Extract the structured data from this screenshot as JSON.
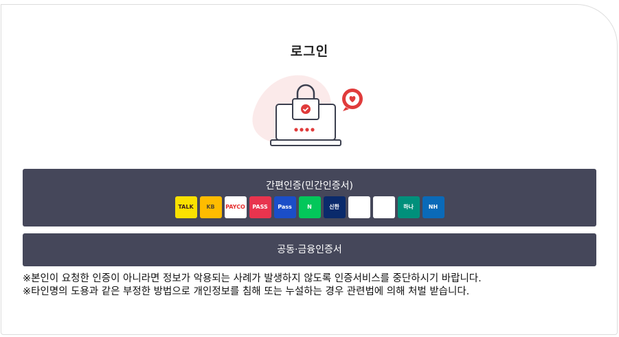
{
  "page": {
    "title": "로그인"
  },
  "simple_auth": {
    "label": "간편인증(민간인증서)",
    "providers": [
      {
        "name": "kakaotalk-icon",
        "text": "TALK",
        "bg": "#fae100",
        "fg": "#3b1e1e"
      },
      {
        "name": "kb-bank-icon",
        "text": "KB",
        "bg": "#ffbc00",
        "fg": "#5a4a2a"
      },
      {
        "name": "payco-icon",
        "text": "PAYCO",
        "bg": "#ffffff",
        "fg": "#e52d2d"
      },
      {
        "name": "pass-icon",
        "text": "PASS",
        "bg": "#e8344e",
        "fg": "#ffffff"
      },
      {
        "name": "samsung-pass-icon",
        "text": "Pass",
        "bg": "#1b4ec8",
        "fg": "#ffffff"
      },
      {
        "name": "naver-icon",
        "text": "N",
        "bg": "#03c75a",
        "fg": "#ffffff"
      },
      {
        "name": "shinhan-bank-icon",
        "text": "신한",
        "bg": "#0a2a6b",
        "fg": "#ffffff"
      },
      {
        "name": "toss-icon",
        "text": "",
        "bg": "#ffffff",
        "fg": "#1a73e8"
      },
      {
        "name": "banksalad-icon",
        "text": "",
        "bg": "#ffffff",
        "fg": "#2bb673"
      },
      {
        "name": "hana-bank-icon",
        "text": "하나",
        "bg": "#00907b",
        "fg": "#ffffff"
      },
      {
        "name": "nh-bank-icon",
        "text": "NH",
        "bg": "#0a6ab8",
        "fg": "#ffffff"
      }
    ]
  },
  "cert_auth": {
    "label": "공동·금융인증서"
  },
  "notices": [
    "※본인이 요청한 인증이 아니라면 정보가 악용되는 사례가 발생하지 않도록 인증서비스를 중단하시기 바랍니다.",
    "※타인명의 도용과 같은 부정한 방법으로 개인정보를 침해 또는 누설하는 경우 관련법에 의해 처벌 받습니다."
  ]
}
